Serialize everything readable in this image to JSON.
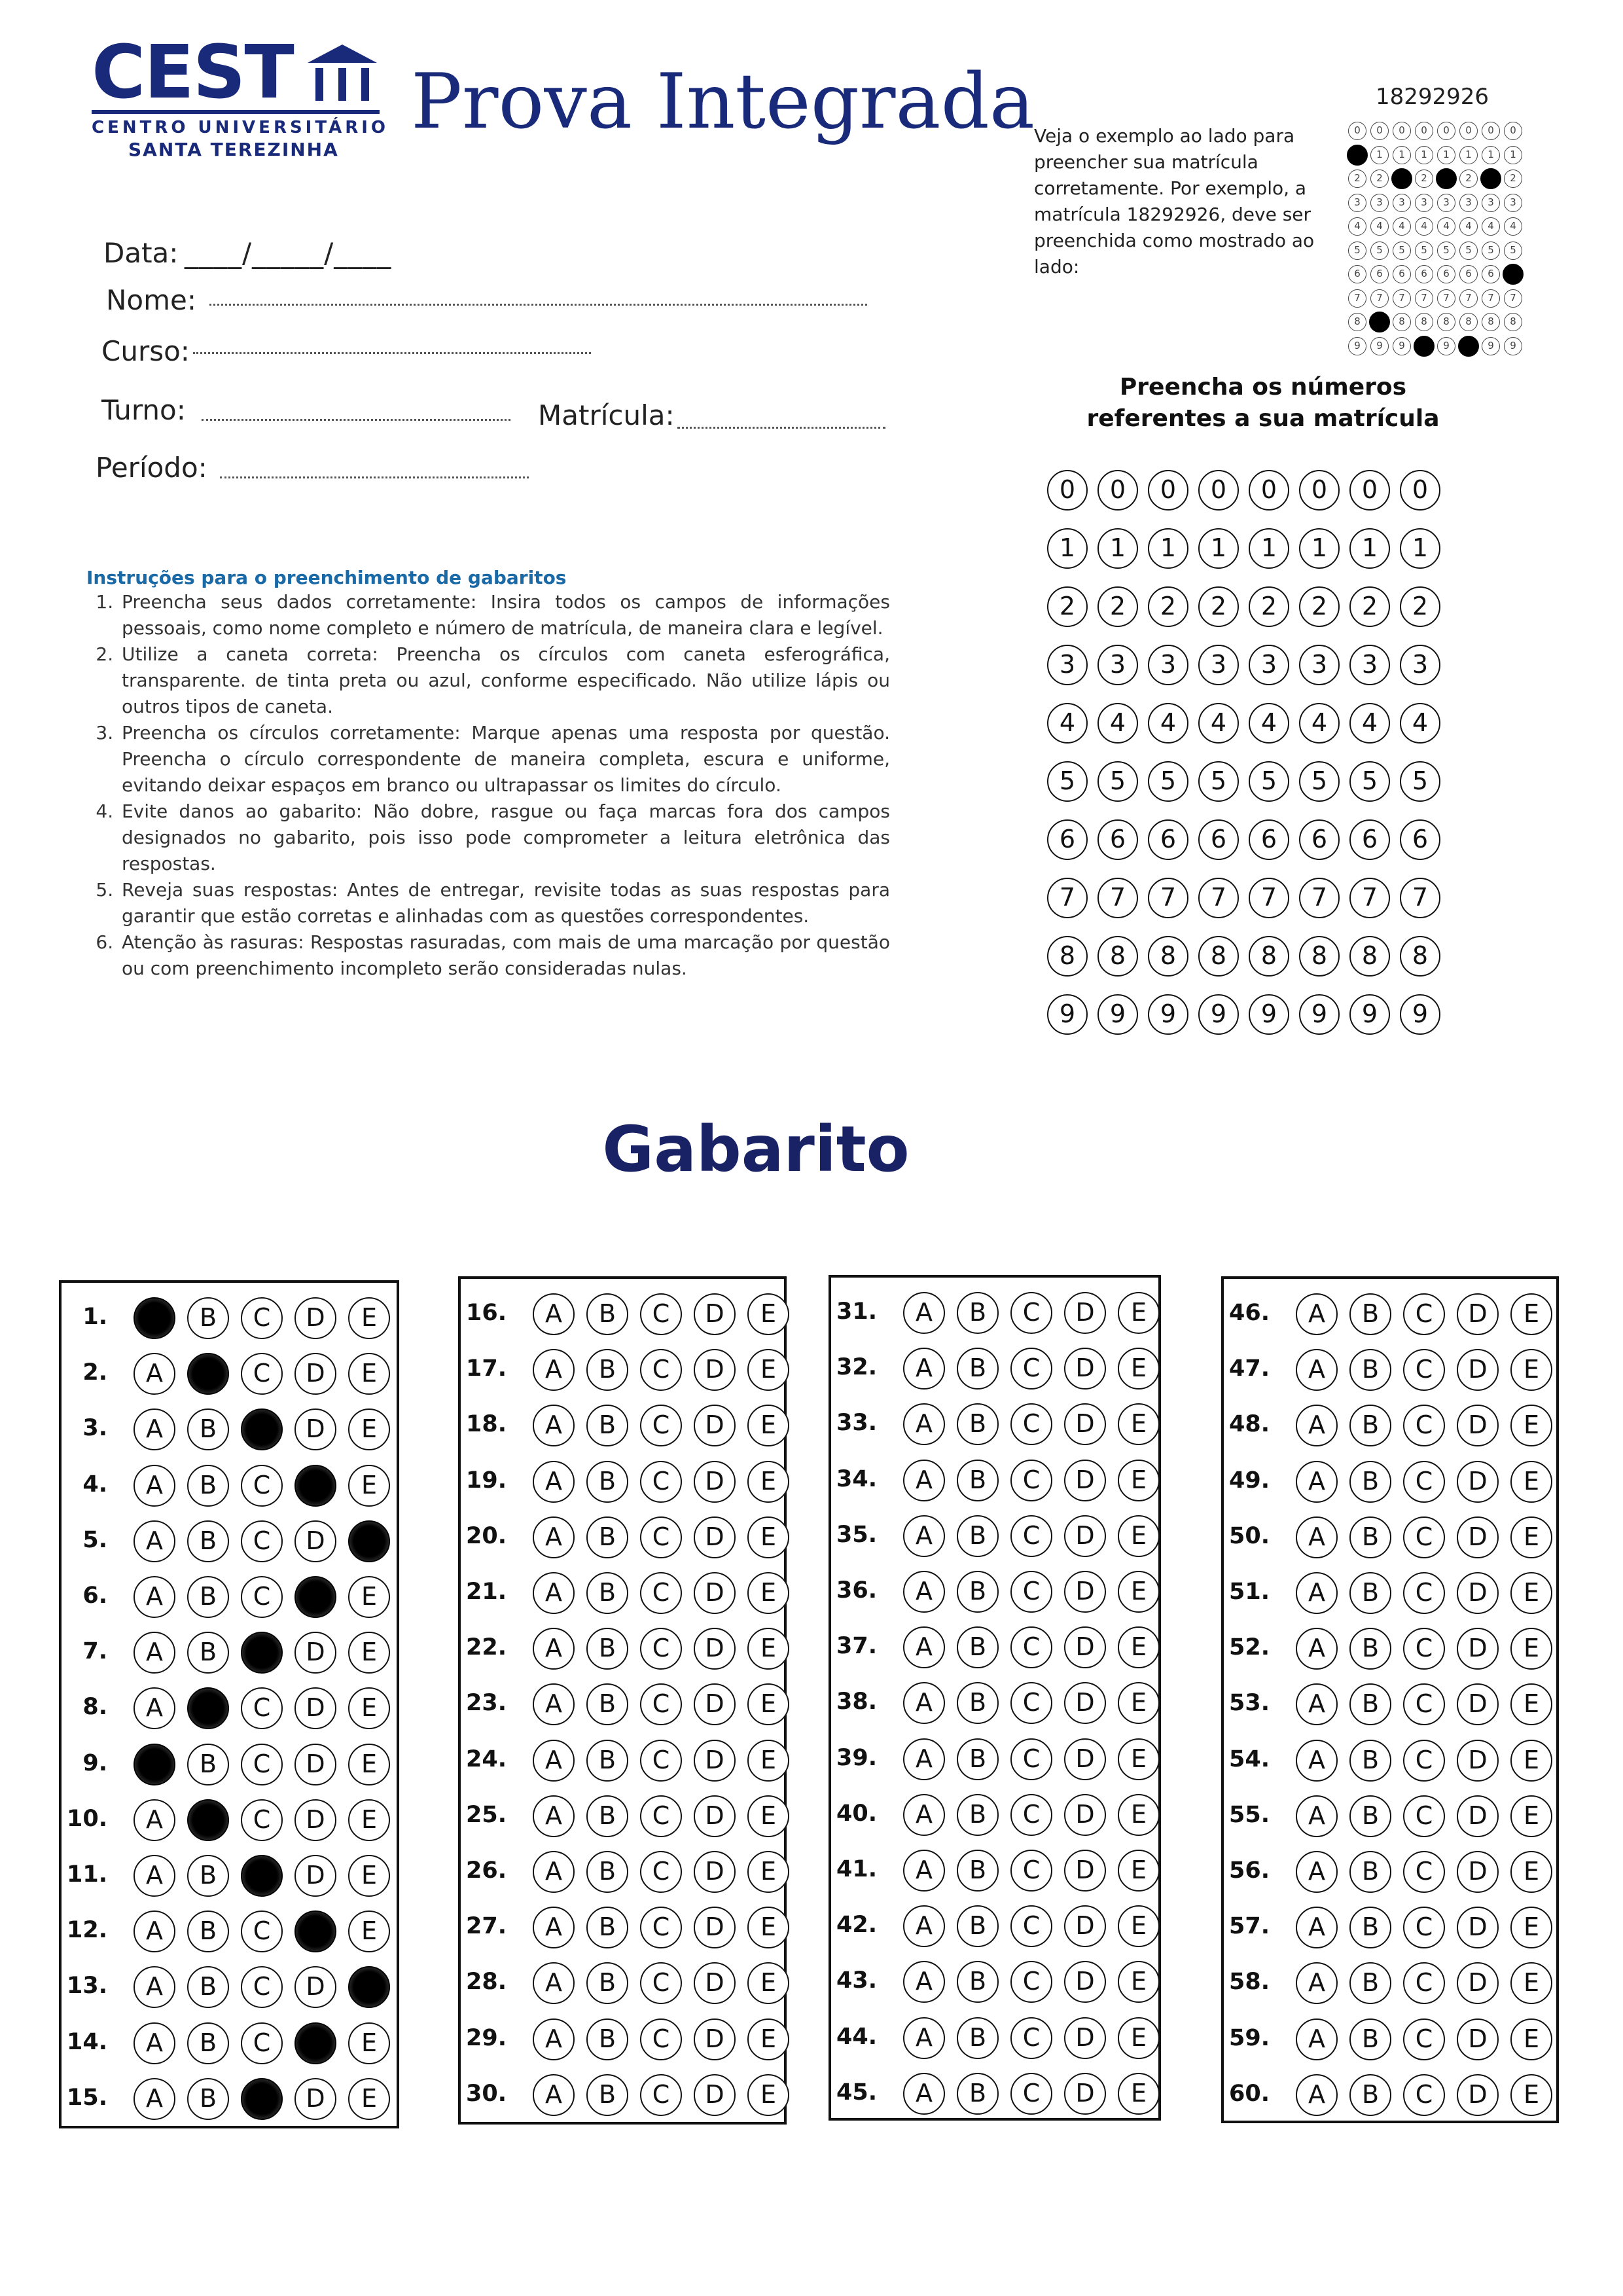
{
  "header": {
    "logo_main": "CEST",
    "logo_line1": "CENTRO UNIVERSITÁRIO",
    "logo_line2": "SANTA TEREZINHA",
    "title": "Prova Integrada"
  },
  "form": {
    "data_label": "Data:",
    "data_blank": "____/_____/____",
    "nome_label": "Nome:",
    "curso_label": "Curso:",
    "turno_label": "Turno:",
    "matricula_label": "Matrícula:",
    "periodo_label": "Período:"
  },
  "instructions": {
    "title": "Instruções  para o preenchimento de gabaritos",
    "items": [
      "Preencha seus dados corretamente: Insira todos os campos de informações pessoais, como nome completo e número de matrícula, de maneira clara e legível.",
      "Utilize a caneta correta: Preencha os círculos com caneta esferográfica, transparente. de tinta preta ou azul, conforme especificado. Não utilize lápis ou outros tipos de caneta.",
      "Preencha os círculos corretamente: Marque apenas uma resposta por questão. Preencha o círculo correspondente de maneira completa, escura e uniforme, evitando deixar espaços em branco ou ultrapassar os limites do círculo.",
      "Evite danos ao gabarito: Não dobre, rasgue ou faça marcas fora dos campos designados no gabarito, pois isso pode comprometer a leitura eletrônica das respostas.",
      "Reveja suas respostas: Antes de entregar, revisite todas as suas respostas para garantir que estão corretas e alinhadas com as questões correspondentes.",
      "Atenção às rasuras: Respostas rasuradas, com mais de uma marcação por questão ou com preenchimento incompleto serão consideradas nulas."
    ]
  },
  "example": {
    "number": "18292926",
    "text": "Veja o exemplo ao lado para preencher sua matrícula corretamente. Por exemplo,  a matrícula 18292926, deve ser preenchida como mostrado ao lado:",
    "digits": [
      1,
      8,
      2,
      9,
      2,
      9,
      2,
      6
    ]
  },
  "matricula_grid": {
    "title_line1": "Preencha os números",
    "title_line2": "referentes a sua matrícula",
    "columns": 8,
    "digits": [
      "0",
      "1",
      "2",
      "3",
      "4",
      "5",
      "6",
      "7",
      "8",
      "9"
    ]
  },
  "gabarito": {
    "title": "Gabarito",
    "options": [
      "A",
      "B",
      "C",
      "D",
      "E"
    ],
    "total_questions": 60,
    "marked": {
      "1": "A",
      "2": "B",
      "3": "C",
      "4": "D",
      "5": "E",
      "6": "D",
      "7": "C",
      "8": "B",
      "9": "A",
      "10": "B",
      "11": "C",
      "12": "D",
      "13": "E",
      "14": "D",
      "15": "C"
    }
  }
}
